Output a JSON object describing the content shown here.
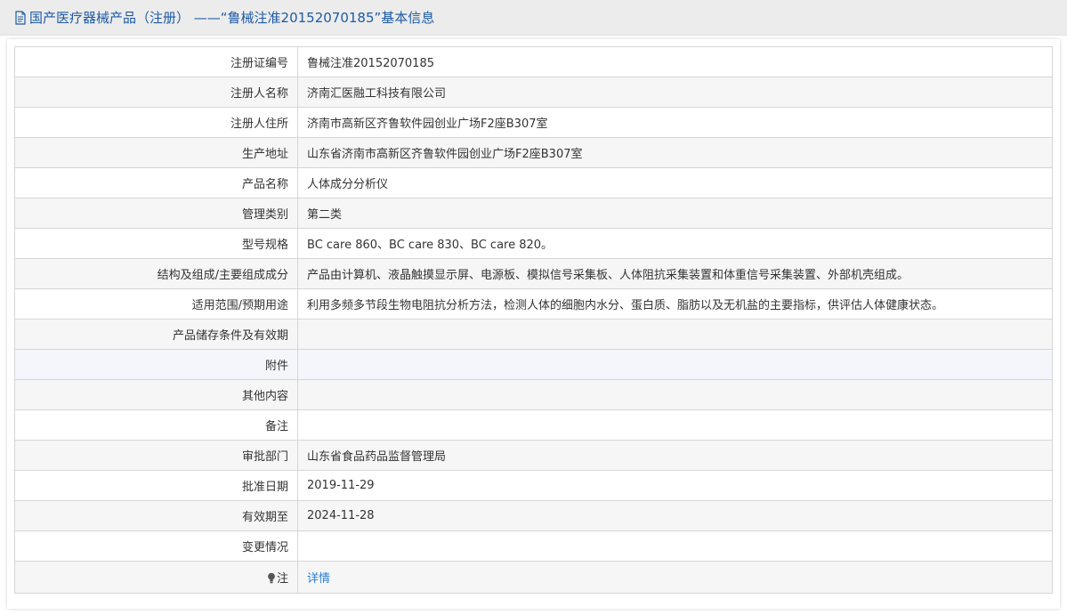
{
  "header": {
    "title": "国产医疗器械产品（注册） ——“鲁械注准20152070185”基本信息",
    "icon": "document-icon",
    "color": "#1d5aa6"
  },
  "rows": [
    {
      "label": "注册证编号",
      "value": "鲁械注准20152070185"
    },
    {
      "label": "注册人名称",
      "value": "济南汇医融工科技有限公司"
    },
    {
      "label": "注册人住所",
      "value": "济南市高新区齐鲁软件园创业广场F2座B307室"
    },
    {
      "label": "生产地址",
      "value": "山东省济南市高新区齐鲁软件园创业广场F2座B307室"
    },
    {
      "label": "产品名称",
      "value": "人体成分分析仪"
    },
    {
      "label": "管理类别",
      "value": "第二类"
    },
    {
      "label": "型号规格",
      "value": "BC care 860、BC care 830、BC care 820。"
    },
    {
      "label": "结构及组成/主要组成成分",
      "value": "产品由计算机、液晶触摸显示屏、电源板、模拟信号采集板、人体阻抗采集装置和体重信号采集装置、外部机壳组成。"
    },
    {
      "label": "适用范围/预期用途",
      "value": "利用多频多节段生物电阻抗分析方法，检测人体的细胞内水分、蛋白质、脂肪以及无机盐的主要指标，供评估人体健康状态。"
    },
    {
      "label": "产品储存条件及有效期",
      "value": ""
    },
    {
      "label": "附件",
      "value": ""
    },
    {
      "label": "其他内容",
      "value": ""
    },
    {
      "label": "备注",
      "value": ""
    },
    {
      "label": "审批部门",
      "value": "山东省食品药品监督管理局"
    },
    {
      "label": "批准日期",
      "value": "2019-11-29"
    },
    {
      "label": "有效期至",
      "value": "2024-11-28"
    },
    {
      "label": "变更情况",
      "value": ""
    }
  ],
  "note": {
    "label": "注",
    "icon": "lightbulb-icon",
    "link_text": "详情",
    "link_color": "#2a7fd4"
  }
}
